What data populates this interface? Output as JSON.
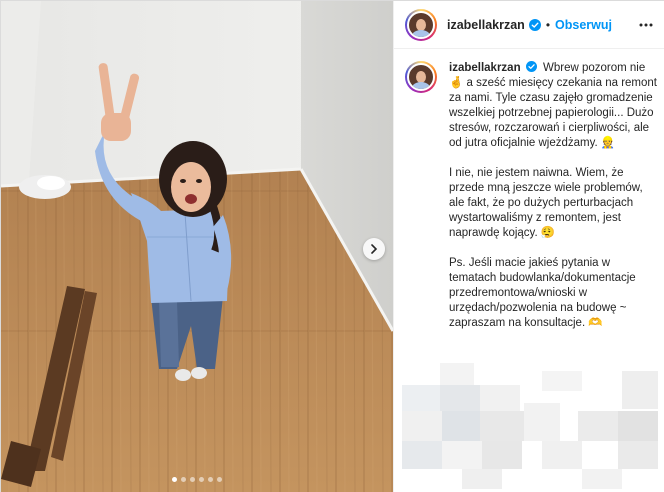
{
  "header": {
    "username": "izabellakrzan",
    "separator": "•",
    "follow_label": "Obserwuj"
  },
  "caption": {
    "username": "izabellakrzan",
    "paragraphs": [
      "Wbrew pozorom nie 🤞 a sześć miesięcy czekania na remont za nami. Tyle czasu zajęło gromadzenie wszelkiej potrzebnej papierologii... Dużo stresów, rozczarowań i cierpliwości, ale od jutra oficjalnie wjeżdżamy. 👷",
      "I nie, nie jestem naiwna. Wiem, że przede mną jeszcze wiele problemów, ale fakt, że po dużych perturbacjach wystartowaliśmy z remontem, jest naprawdę kojący. 😮‍💨",
      "Ps. Jeśli macie jakieś pytania w tematach budowlanka/dokumentacje przedremontowa/wnioski w urzędach/pozwolenia na budowę ~ zapraszam na konsultacje. 🫶"
    ]
  },
  "carousel": {
    "slide_count": 6,
    "active_index": 0
  },
  "icons": {
    "verified": "verified-badge-icon",
    "more": "more-options-icon",
    "next": "chevron-right-icon"
  },
  "colors": {
    "accent": "#0095f6",
    "text": "#262626",
    "floor": "#b98a5c"
  }
}
